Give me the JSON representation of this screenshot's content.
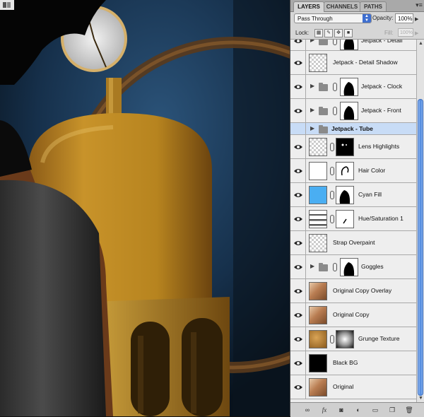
{
  "panel": {
    "tabs": [
      {
        "label": "LAYERS",
        "active": true
      },
      {
        "label": "CHANNELS",
        "active": false
      },
      {
        "label": "PATHS",
        "active": false
      }
    ],
    "menu_icon": "panel-menu-icon",
    "blend_mode": "Pass Through",
    "opacity_label": "Opacity:",
    "opacity_value": "100%",
    "lock_label": "Lock:",
    "fill_label": "Fill:",
    "fill_value": "100%"
  },
  "layers": [
    {
      "name": "Jetpack - Detail",
      "type": "group",
      "visible": true
    },
    {
      "name": "Jetpack - Detail Shadow",
      "type": "layer",
      "visible": true
    },
    {
      "name": "Jetpack - Clock",
      "type": "group",
      "visible": true
    },
    {
      "name": "Jetpack - Front",
      "type": "group",
      "visible": true
    },
    {
      "name": "Jetpack - Tube",
      "type": "group",
      "visible": false,
      "selected": true
    },
    {
      "name": "Lens Highlights",
      "type": "masked",
      "visible": true
    },
    {
      "name": "Hair Color",
      "type": "masked",
      "visible": true
    },
    {
      "name": "Cyan Fill",
      "type": "fill",
      "visible": true
    },
    {
      "name": "Hue/Saturation 1",
      "type": "adjustment",
      "visible": true
    },
    {
      "name": "Strap Overpaint",
      "type": "layer",
      "visible": true
    },
    {
      "name": "Goggles",
      "type": "group",
      "visible": true
    },
    {
      "name": "Original Copy Overlay",
      "type": "photo",
      "visible": true
    },
    {
      "name": "Original Copy",
      "type": "photo",
      "visible": true
    },
    {
      "name": "Grunge Texture",
      "type": "texture",
      "visible": true
    },
    {
      "name": "Black BG",
      "type": "solid",
      "visible": true
    },
    {
      "name": "Original",
      "type": "photo",
      "visible": true
    }
  ],
  "colors": {
    "selected_row": "#c8dcf6",
    "cyan_fill": "#4aaef2",
    "jetpack_gold": "#c8932a",
    "background_blue": "#1d3c5c"
  },
  "bottom_icons": [
    "link-layers-icon",
    "fx-icon",
    "add-mask-icon",
    "adjustment-layer-icon",
    "new-group-icon",
    "new-layer-icon",
    "trash-icon"
  ],
  "bottom_labels": {
    "fx": "fx"
  }
}
